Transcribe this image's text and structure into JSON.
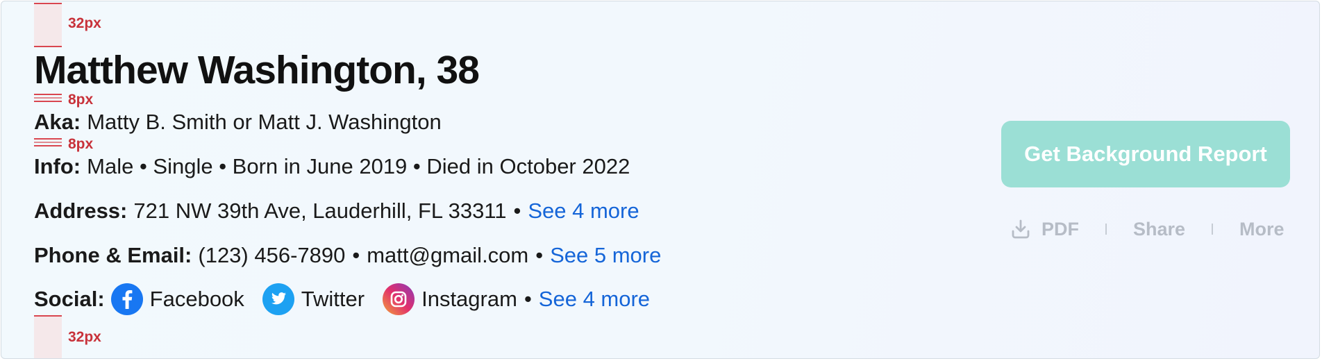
{
  "spacers": {
    "top_label": "32px",
    "gap1_label": "8px",
    "gap2_label": "8px",
    "bottom_label": "32px"
  },
  "person": {
    "name": "Matthew Washington, 38",
    "aka_label": "Aka:",
    "aka_value": "Matty B. Smith or Matt J. Washington",
    "info_label": "Info:",
    "info_value": "Male • Single • Born in June 2019 • Died in October 2022",
    "address_label": "Address:",
    "address_value": "721 NW 39th Ave, Lauderhill, FL 33311",
    "address_more": "See 4 more",
    "contact_label": "Phone & Email:",
    "phone": "(123) 456-7890",
    "email": "matt@gmail.com",
    "contact_more": "See 5 more",
    "social_label": "Social:",
    "social": [
      {
        "name": "Facebook",
        "icon": "facebook-icon",
        "color": "#1877f2"
      },
      {
        "name": "Twitter",
        "icon": "twitter-icon",
        "color": "#1da1f2"
      },
      {
        "name": "Instagram",
        "icon": "instagram-icon",
        "color": "#c13584"
      }
    ],
    "social_more": "See 4 more",
    "bullet": "•"
  },
  "actions": {
    "report_button": "Get Background Report",
    "pdf": "PDF",
    "share": "Share",
    "more": "More"
  },
  "colors": {
    "accent_teal": "#9bdfd5",
    "link_blue": "#1565d8",
    "spacer_red": "#d9464f",
    "muted_action": "#b6bcc6"
  }
}
